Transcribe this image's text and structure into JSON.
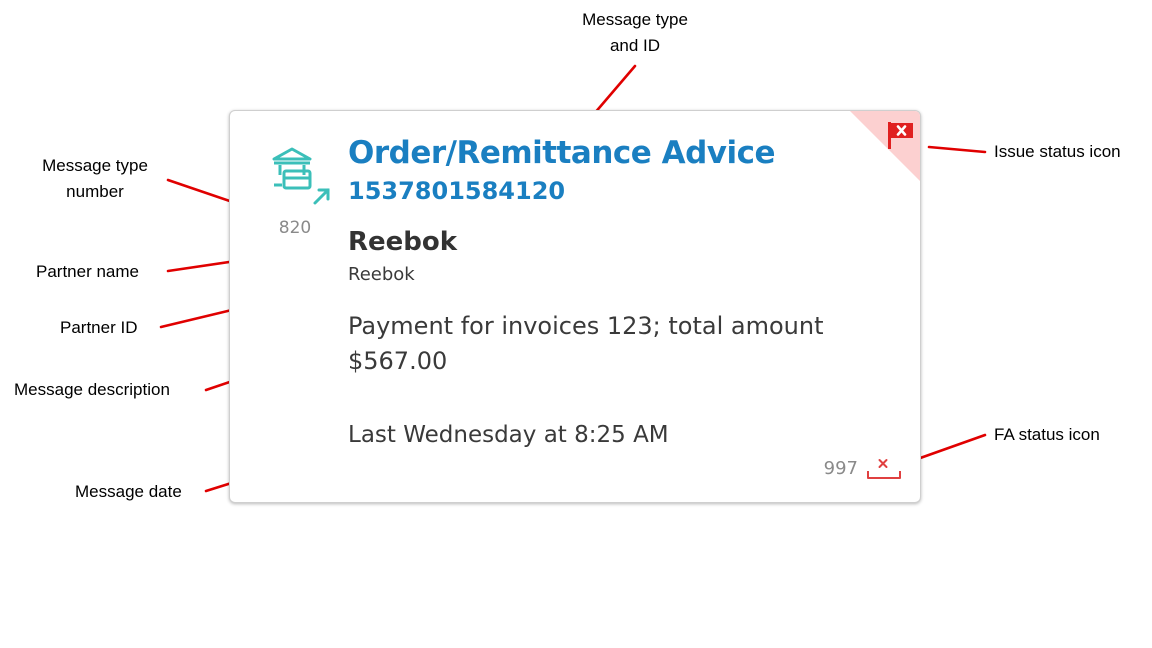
{
  "card": {
    "message_type": "Order/Remittance Advice",
    "message_id": "1537801584120",
    "message_type_number": "820",
    "partner_name": "Reebok",
    "partner_id": "Reebok",
    "description": "Payment for invoices 123; total amount $567.00",
    "date": "Last Wednesday at 8:25 AM",
    "fa_code": "997",
    "icons": {
      "type": "remittance-bank-icon",
      "issue_status": "red-flag-x-icon",
      "fa_status": "inbox-x-icon"
    },
    "colors": {
      "accent": "#1a7fc1",
      "type_icon": "#3bbfb9",
      "issue": "#e02020",
      "issue_corner": "#fcd0d0",
      "fa_status": "#e04040"
    }
  },
  "annotations": {
    "message_type_and_id_line1": "Message type",
    "message_type_and_id_line2": "and ID",
    "message_type_number_line1": "Message type",
    "message_type_number_line2": "number",
    "partner_name": "Partner name",
    "partner_id": "Partner ID",
    "message_description": "Message description",
    "message_date": "Message date",
    "issue_status_icon": "Issue status icon",
    "fa_status_icon": "FA status icon"
  }
}
